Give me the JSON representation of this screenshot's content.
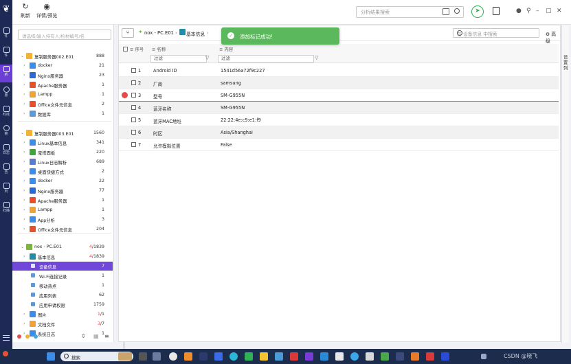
{
  "rail": {
    "items": [
      {
        "label": "件",
        "icon": "file-icon"
      },
      {
        "label": "件",
        "icon": "folder-icon"
      },
      {
        "label": "析",
        "icon": "analysis-icon"
      },
      {
        "label": "置",
        "icon": "settings-icon"
      },
      {
        "label": "时线",
        "icon": "timeline-icon"
      },
      {
        "label": "索",
        "icon": "search-icon"
      },
      {
        "label": "日志",
        "icon": "log-icon"
      },
      {
        "label": "告",
        "icon": "report-icon"
      },
      {
        "label": "列",
        "icon": "list-icon"
      },
      {
        "label": "扫描",
        "icon": "scan-icon"
      }
    ]
  },
  "toolbar": {
    "refresh_label": "刷新",
    "preview_label": "详情/预览",
    "search_placeholder": "分析结果搜索"
  },
  "left": {
    "search_placeholder": "请选择/输入持有人/检材编号/名",
    "tree": [
      {
        "label": "复制服务器002.E01",
        "count": "888",
        "level": 0
      },
      {
        "label": "docker",
        "count": "21",
        "level": 1
      },
      {
        "label": "Nginx服务器",
        "count": "23",
        "level": 1
      },
      {
        "label": "Apache服务器",
        "count": "1",
        "level": 1
      },
      {
        "label": "Lampp",
        "count": "1",
        "level": 1
      },
      {
        "label": "Office文件元信息",
        "count": "2",
        "level": 1
      },
      {
        "label": "数据库",
        "count": "1",
        "level": 1
      },
      {
        "label": "复制服务器003.E01",
        "count": "1560",
        "level": 0
      },
      {
        "label": "Linux基本信息",
        "count": "341",
        "level": 1
      },
      {
        "label": "宝塔面板",
        "count": "220",
        "level": 1
      },
      {
        "label": "Linux日志解析",
        "count": "689",
        "level": 1
      },
      {
        "label": "桌面快捷方式",
        "count": "2",
        "level": 1
      },
      {
        "label": "docker",
        "count": "22",
        "level": 1
      },
      {
        "label": "Nginx服务器",
        "count": "77",
        "level": 1
      },
      {
        "label": "Apache服务器",
        "count": "1",
        "level": 1
      },
      {
        "label": "Lampp",
        "count": "1",
        "level": 1
      },
      {
        "label": "App分析",
        "count": "3",
        "level": 1
      },
      {
        "label": "Office文件元信息",
        "count": "204",
        "level": 1
      },
      {
        "label": "nox - PC.E01",
        "count_red": "4",
        "count": "/1839",
        "level": 0
      },
      {
        "label": "基本信息",
        "count_red": "4",
        "count": "/1839",
        "level": 1
      },
      {
        "label": "设备信息",
        "count": "7",
        "level": 2,
        "selected": true
      },
      {
        "label": "Wi-Fi连接记录",
        "count": "1",
        "level": 2
      },
      {
        "label": "移动热点",
        "count": "1",
        "level": 2
      },
      {
        "label": "应用列表",
        "count": "62",
        "level": 2
      },
      {
        "label": "应用申请权限",
        "count": "1759",
        "level": 2
      },
      {
        "label": "图片",
        "count_red": "1",
        "count": "/1",
        "level": 1
      },
      {
        "label": "文档文件",
        "count_red": "3",
        "count": "/7",
        "level": 1
      },
      {
        "label": "系统日志",
        "count": "1",
        "level": 1
      }
    ]
  },
  "main": {
    "breadcrumb": {
      "root": "nox - PC.E01",
      "section": "基本信息"
    },
    "search_placeholder": "在 设备信息 中搜索",
    "advanced_label": "高级",
    "columns": {
      "index": "序号",
      "name": "名称",
      "content": "内容"
    },
    "filter_placeholder": "过滤",
    "rows": [
      {
        "index": "1",
        "name": "Android ID",
        "content": "1541d56a72f9c227"
      },
      {
        "index": "2",
        "name": "厂商",
        "content": "samsung"
      },
      {
        "index": "3",
        "name": "型号",
        "content": "SM-G955N",
        "marked": true
      },
      {
        "index": "4",
        "name": "蓝牙名称",
        "content": "SM-G955N"
      },
      {
        "index": "5",
        "name": "蓝牙MAC地址",
        "content": "22:22:4e:c9:e1:f9"
      },
      {
        "index": "6",
        "name": "时区",
        "content": "Asia/Shanghai"
      },
      {
        "index": "7",
        "name": "允许模拟位置",
        "content": "False"
      }
    ],
    "side_label": "设置列"
  },
  "toast": {
    "message": "添加标记成功!"
  },
  "taskbar": {
    "search_label": "搜索",
    "watermark": "CSDN @晓飞"
  }
}
